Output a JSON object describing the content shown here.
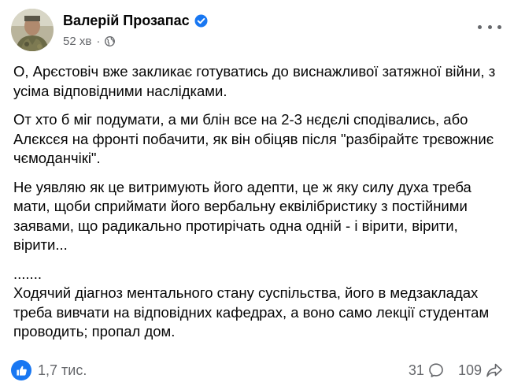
{
  "post": {
    "author": "Валерій Прозапас",
    "timestamp": "52 хв",
    "separator": "·",
    "icons": {
      "verified": "verified-badge-icon",
      "audience": "globe-icon",
      "menu": "more-horizontal-icon",
      "like": "thumbs-up-icon",
      "comment": "comment-icon",
      "share": "share-icon"
    },
    "paragraphs": [
      "О, Арєстовіч вже закликає готуватись до виснажливої затяжної війни, з усіма відповідними наслідками.",
      "От хто б міг подумати, а ми блін все на 2-3 нєдєлі сподівались,  або Алєксєя на фронті побачити, як він обіцяв після \"разбірайтє трєвожниє чємоданчікі\".",
      "Не уявляю як це витримують його адепти, це ж яку силу духа треба мати, щоби сприймати його вербальну еквілібристику з постійними заявами, що радикально протирічать одна одній - і вірити, вірити, вірити...",
      ".......",
      "Ходячий діагноз ментального стану суспільства, його в медзакладах треба вивчати на відповідних кафедрах, а воно само лекції студентам проводить; пропал дом."
    ]
  },
  "footer": {
    "reactions": "1,7 тис.",
    "comments": "31",
    "shares": "109"
  },
  "colors": {
    "accent": "#1877f2",
    "text": "#050505",
    "secondary_text": "#65676b"
  }
}
